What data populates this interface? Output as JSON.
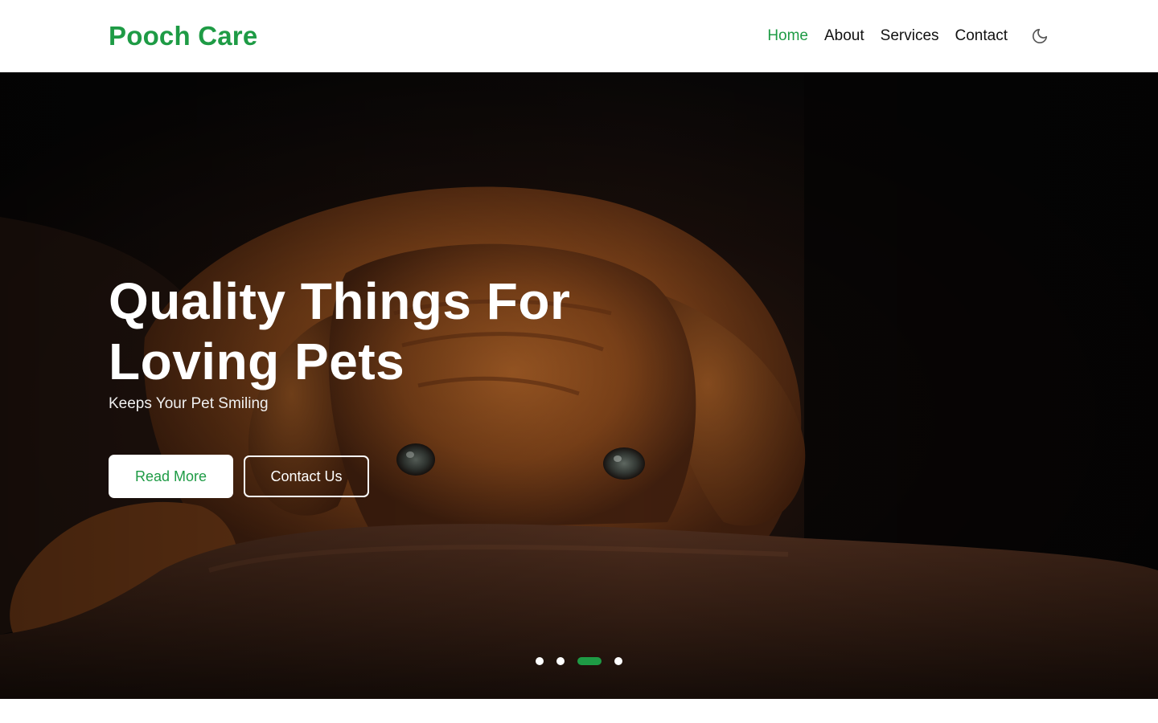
{
  "brand": {
    "name": "Pooch Care",
    "accent": "#1e9b45"
  },
  "nav": {
    "items": [
      {
        "label": "Home",
        "active": true
      },
      {
        "label": "About",
        "active": false
      },
      {
        "label": "Services",
        "active": false
      },
      {
        "label": "Contact",
        "active": false
      }
    ],
    "theme_toggle_icon": "moon-icon"
  },
  "hero": {
    "image": "puppy lying on brown rug",
    "title_line1": "Quality Things For",
    "title_line2": "Loving Pets",
    "subtitle": "Keeps Your Pet Smiling",
    "primary_button": "Read More",
    "secondary_button": "Contact Us",
    "slides_total": 4,
    "active_slide": 3
  }
}
